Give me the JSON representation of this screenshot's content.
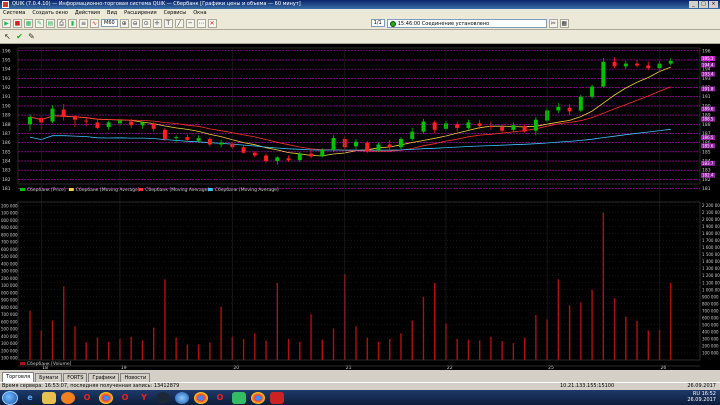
{
  "window": {
    "title": "QUIK (7.0.4.10) — Информационно-торговая система QUIK — Сбербанк [Графики цены и объема — 60 минут]"
  },
  "menu": [
    "Система",
    "Создать окно",
    "Действия",
    "Вид",
    "Расширения",
    "Сервисы",
    "Окна"
  ],
  "toolbar": {
    "interval": "M60",
    "connection": "15:46:00 Соединение установлено",
    "counter": "1/1"
  },
  "price_panel": {
    "legend": [
      "Сбербанк [Price]",
      "Сбербанк [Moving Average]",
      "Сбербанк [Moving Average]",
      "Сбербанк [Moving Average]"
    ],
    "y_ticks": [
      "196",
      "195",
      "194",
      "193",
      "192",
      "191",
      "190",
      "189",
      "188",
      "187",
      "186",
      "185",
      "184",
      "183",
      "182",
      "181"
    ],
    "right_labels": [
      "195.1",
      "194.4",
      "193.4",
      "191.8",
      "189.6",
      "188.5",
      "186.5",
      "185.6",
      "183.7",
      "182.4"
    ]
  },
  "volume_panel": {
    "legend": [
      "Сбербанк [Volume]"
    ],
    "y_ticks": [
      "2 200 000",
      "2 100 000",
      "2 000 000",
      "1 900 000",
      "1 800 000",
      "1 700 000",
      "1 600 000",
      "1 500 000",
      "1 400 000",
      "1 300 000",
      "1 200 000",
      "1 100 000",
      "1 000 000",
      "900 000",
      "800 000",
      "700 000",
      "600 000",
      "500 000",
      "400 000",
      "300 000",
      "200 000",
      "100 000"
    ],
    "y_ticks_left": [
      "200 000",
      "100 000",
      "000 000",
      "900 000",
      "800 000",
      "700 000",
      "600 000",
      "500 000",
      "400 000",
      "300 000",
      "200 000",
      "100 000",
      "000 000",
      "900 000",
      "800 000",
      "700 000",
      "600 000",
      "500 000",
      "400 000",
      "300 000",
      "200 000",
      "100 000"
    ]
  },
  "x_labels": [
    "18",
    "19",
    "20",
    "21",
    "22",
    "25",
    "26"
  ],
  "tabs": [
    "Торговля",
    "Бумаги",
    "FORTS",
    "Графики",
    "Новости"
  ],
  "status": {
    "left": "Время сервера: 16:53:07, последняя полученная запись: 13412879",
    "ip": "10.21.133.155:15100",
    "right_time": "26.09.2017"
  },
  "tray": {
    "lang": "RU",
    "time": "16:52",
    "date": "26.09.2017"
  },
  "taskbar_apps": [
    "ie",
    "folder",
    "media",
    "opera",
    "chrome",
    "opera",
    "yandex",
    "steam",
    "globe",
    "chrome",
    "opera",
    "app",
    "chrome",
    "app"
  ],
  "colors": {
    "up": "#00c000",
    "down": "#ff2020",
    "ma_fast": "#f0d040",
    "ma_mid": "#ff3030",
    "ma_slow": "#40c0ff",
    "grid": "#c000c0",
    "volume": "#b01010"
  },
  "candles": [
    [
      188.0,
      189.1,
      187.3,
      188.8
    ],
    [
      188.7,
      188.9,
      187.4,
      188.2
    ],
    [
      188.3,
      190.1,
      188.1,
      189.7
    ],
    [
      189.6,
      190.2,
      188.4,
      188.8
    ],
    [
      188.9,
      189.0,
      187.7,
      188.5
    ],
    [
      188.4,
      188.8,
      187.8,
      188.3
    ],
    [
      188.2,
      188.6,
      187.5,
      187.6
    ],
    [
      187.7,
      188.4,
      187.4,
      188.2
    ],
    [
      188.1,
      188.6,
      187.8,
      188.4
    ],
    [
      188.3,
      188.6,
      187.6,
      187.9
    ],
    [
      187.9,
      188.3,
      187.5,
      188.2
    ],
    [
      188.1,
      188.2,
      187.2,
      187.5
    ],
    [
      187.4,
      187.6,
      186.2,
      186.4
    ],
    [
      186.5,
      186.8,
      186.0,
      186.6
    ],
    [
      186.6,
      186.9,
      186.1,
      186.3
    ],
    [
      186.2,
      186.8,
      186.0,
      186.5
    ],
    [
      186.4,
      186.6,
      185.6,
      185.8
    ],
    [
      185.8,
      186.3,
      185.5,
      186.0
    ],
    [
      185.9,
      186.0,
      185.3,
      185.5
    ],
    [
      185.5,
      185.7,
      184.8,
      184.9
    ],
    [
      184.9,
      185.1,
      184.4,
      184.6
    ],
    [
      184.6,
      184.8,
      183.8,
      184.0
    ],
    [
      184.0,
      184.5,
      183.6,
      184.4
    ],
    [
      184.3,
      184.6,
      183.9,
      184.1
    ],
    [
      184.1,
      185.0,
      183.9,
      184.8
    ],
    [
      184.8,
      185.2,
      184.3,
      184.5
    ],
    [
      184.5,
      185.4,
      184.4,
      185.2
    ],
    [
      185.2,
      186.8,
      185.0,
      186.5
    ],
    [
      186.4,
      186.7,
      185.3,
      185.5
    ],
    [
      185.6,
      186.4,
      185.3,
      186.1
    ],
    [
      186.0,
      186.2,
      184.9,
      185.1
    ],
    [
      185.2,
      186.0,
      185.0,
      185.8
    ],
    [
      185.8,
      186.3,
      185.2,
      185.5
    ],
    [
      185.5,
      186.6,
      185.3,
      186.4
    ],
    [
      186.4,
      187.6,
      186.2,
      187.2
    ],
    [
      187.2,
      188.6,
      187.0,
      188.3
    ],
    [
      188.2,
      188.4,
      187.0,
      187.4
    ],
    [
      187.5,
      188.4,
      187.3,
      188.1
    ],
    [
      188.0,
      188.3,
      187.2,
      187.6
    ],
    [
      187.6,
      188.5,
      187.4,
      188.2
    ],
    [
      188.1,
      188.5,
      187.5,
      187.8
    ],
    [
      187.8,
      188.3,
      187.4,
      187.7
    ],
    [
      187.7,
      187.9,
      187.1,
      187.3
    ],
    [
      187.4,
      188.2,
      187.2,
      187.9
    ],
    [
      187.8,
      188.0,
      187.1,
      187.2
    ],
    [
      187.3,
      188.8,
      186.8,
      188.5
    ],
    [
      188.4,
      189.8,
      188.2,
      189.5
    ],
    [
      189.5,
      190.3,
      189.2,
      189.9
    ],
    [
      189.8,
      190.2,
      189.0,
      189.4
    ],
    [
      189.5,
      191.2,
      189.3,
      191.0
    ],
    [
      191.0,
      192.3,
      190.8,
      192.1
    ],
    [
      192.1,
      195.2,
      192.0,
      194.8
    ],
    [
      194.8,
      195.3,
      194.1,
      194.3
    ],
    [
      194.3,
      194.9,
      194.0,
      194.6
    ],
    [
      194.6,
      195.0,
      194.2,
      194.4
    ],
    [
      194.4,
      194.8,
      193.9,
      194.1
    ],
    [
      194.1,
      194.9,
      193.8,
      194.6
    ],
    [
      194.6,
      195.2,
      194.4,
      194.9
    ]
  ],
  "volumes": [
    700000,
    420000,
    560000,
    1050000,
    480000,
    250000,
    320000,
    260000,
    300000,
    330000,
    280000,
    460000,
    1150000,
    320000,
    220000,
    220000,
    250000,
    760000,
    330000,
    300000,
    380000,
    280000,
    1100000,
    300000,
    260000,
    650000,
    290000,
    450000,
    1220000,
    480000,
    320000,
    260000,
    300000,
    380000,
    560000,
    900000,
    1100000,
    520000,
    300000,
    290000,
    280000,
    330000,
    270000,
    240000,
    320000,
    640000,
    580000,
    1150000,
    780000,
    820000,
    1000000,
    2100000,
    880000,
    620000,
    560000,
    420000,
    430000,
    1100000
  ]
}
